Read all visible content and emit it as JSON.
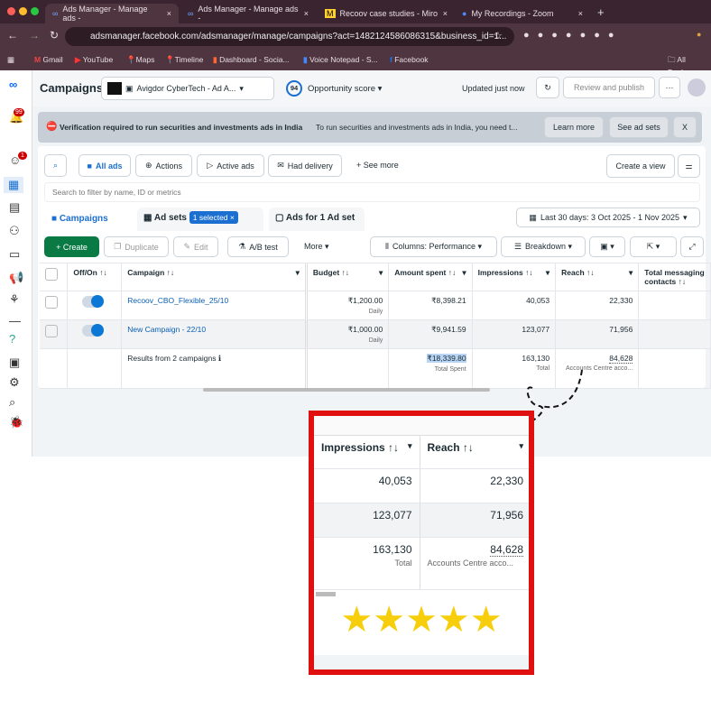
{
  "browser": {
    "tabs": [
      "Ads Manager - Manage ads -",
      "Ads Manager - Manage ads -",
      "Recoov case studies - Miro",
      "My Recordings - Zoom"
    ],
    "url": "adsmanager.facebook.com/adsmanager/manage/campaigns?act=1482124586086315&business_id=1...",
    "bookmarks": [
      "Gmail",
      "YouTube",
      "Maps",
      "Timeline",
      "Dashboard - Socia...",
      "Voice Notepad - S...",
      "Facebook"
    ],
    "all_bookmarks": "All Bookm"
  },
  "header": {
    "title": "Campaigns",
    "account": "Avigdor CyberTech - Ad A...",
    "score": "94",
    "score_label": "Opportunity score",
    "updated": "Updated just now",
    "review": "Review and publish",
    "more": "···"
  },
  "sidebar": {
    "notif_badge": "99",
    "badge2": "1"
  },
  "banner": {
    "title": "Verification required to run securities and investments ads in India",
    "text": "To run securities and investments ads in India, you need t...",
    "learn": "Learn more",
    "see": "See ad sets",
    "close": "X"
  },
  "filters": {
    "all_ads": "All ads",
    "actions": "Actions",
    "active": "Active ads",
    "delivery": "Had delivery",
    "see_more": "+ See more",
    "create_view": "Create a view",
    "search_placeholder": "Search to filter by name, ID or metrics"
  },
  "levels": {
    "campaigns": "Campaigns",
    "adsets": "Ad sets",
    "selected": "1 selected",
    "ads": "Ads for 1 Ad set",
    "date": "Last 30 days: 3 Oct 2025 - 1 Nov 2025"
  },
  "toolbar": {
    "create": "+ Create",
    "duplicate": "Duplicate",
    "edit": "Edit",
    "ab": "A/B test",
    "more": "More ▾",
    "columns": "Columns: Performance ▾",
    "breakdown": "Breakdown ▾"
  },
  "table": {
    "headers": [
      "Off/On ↑↓",
      "Campaign ↑↓",
      "Budget ↑↓",
      "Amount spent ↑↓",
      "Impressions ↑↓",
      "Reach ↑↓",
      "Total messaging contacts ↑↓"
    ],
    "rows": [
      {
        "name": "Recoov_CBO_Flexible_25/10",
        "budget": "₹1,200.00",
        "budget_type": "Daily",
        "spent": "₹8,398.21",
        "impressions": "40,053",
        "reach": "22,330"
      },
      {
        "name": "New Campaign - 22/10",
        "budget": "₹1,000.00",
        "budget_type": "Daily",
        "spent": "₹9,941.59",
        "impressions": "123,077",
        "reach": "71,956"
      }
    ],
    "summary": {
      "label": "Results from 2 campaigns",
      "spent": "₹18,339.80",
      "spent_sub": "Total Spent",
      "impressions": "163,130",
      "impressions_sub": "Total",
      "reach": "84,628",
      "reach_sub": "Accounts Centre acco..."
    }
  },
  "zoom": {
    "impressions": "Impressions ↑↓",
    "reach": "Reach ↑↓",
    "rating": 5,
    "stars": "★★★★★"
  }
}
